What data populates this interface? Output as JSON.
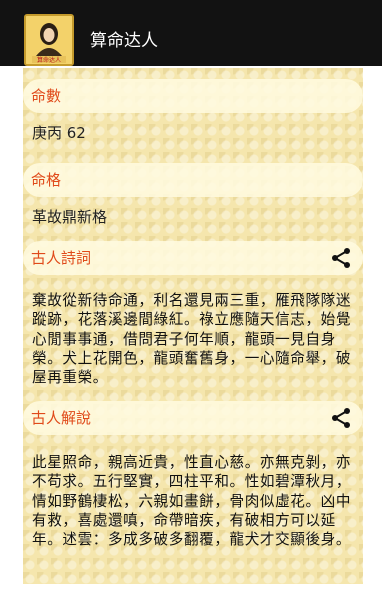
{
  "app": {
    "title": "算命达人",
    "icon_caption": "算命达人"
  },
  "sections": {
    "mingshu": {
      "title": "命數",
      "value": "庚丙 62"
    },
    "mingge": {
      "title": "命格",
      "value": "革故鼎新格"
    },
    "poem": {
      "title": "古人詩詞",
      "text": "棄故從新待命通，利名還見兩三重，雁飛隊隊迷蹤跡，花落溪邊間綠紅。祿立應隨天信志，始覺心閒事事通，借問君子何年順，龍頭一見自身榮。犬上花開色，龍頭奮舊身，一心隨命舉，破屋再重榮。"
    },
    "explain": {
      "title": "古人解說",
      "text": "此星照命，親高近貴，性直心慈。亦無克剝，亦不苟求。五行堅實，四柱平和。性如碧潭秋月，情如野鶴棲松，六親如畫餅，骨肉似虛花。凶中有救，喜處還嗔，命帶暗疾，有破相方可以延年。述雲：多成多破多翻覆，龍犬才交顯後身。"
    }
  }
}
